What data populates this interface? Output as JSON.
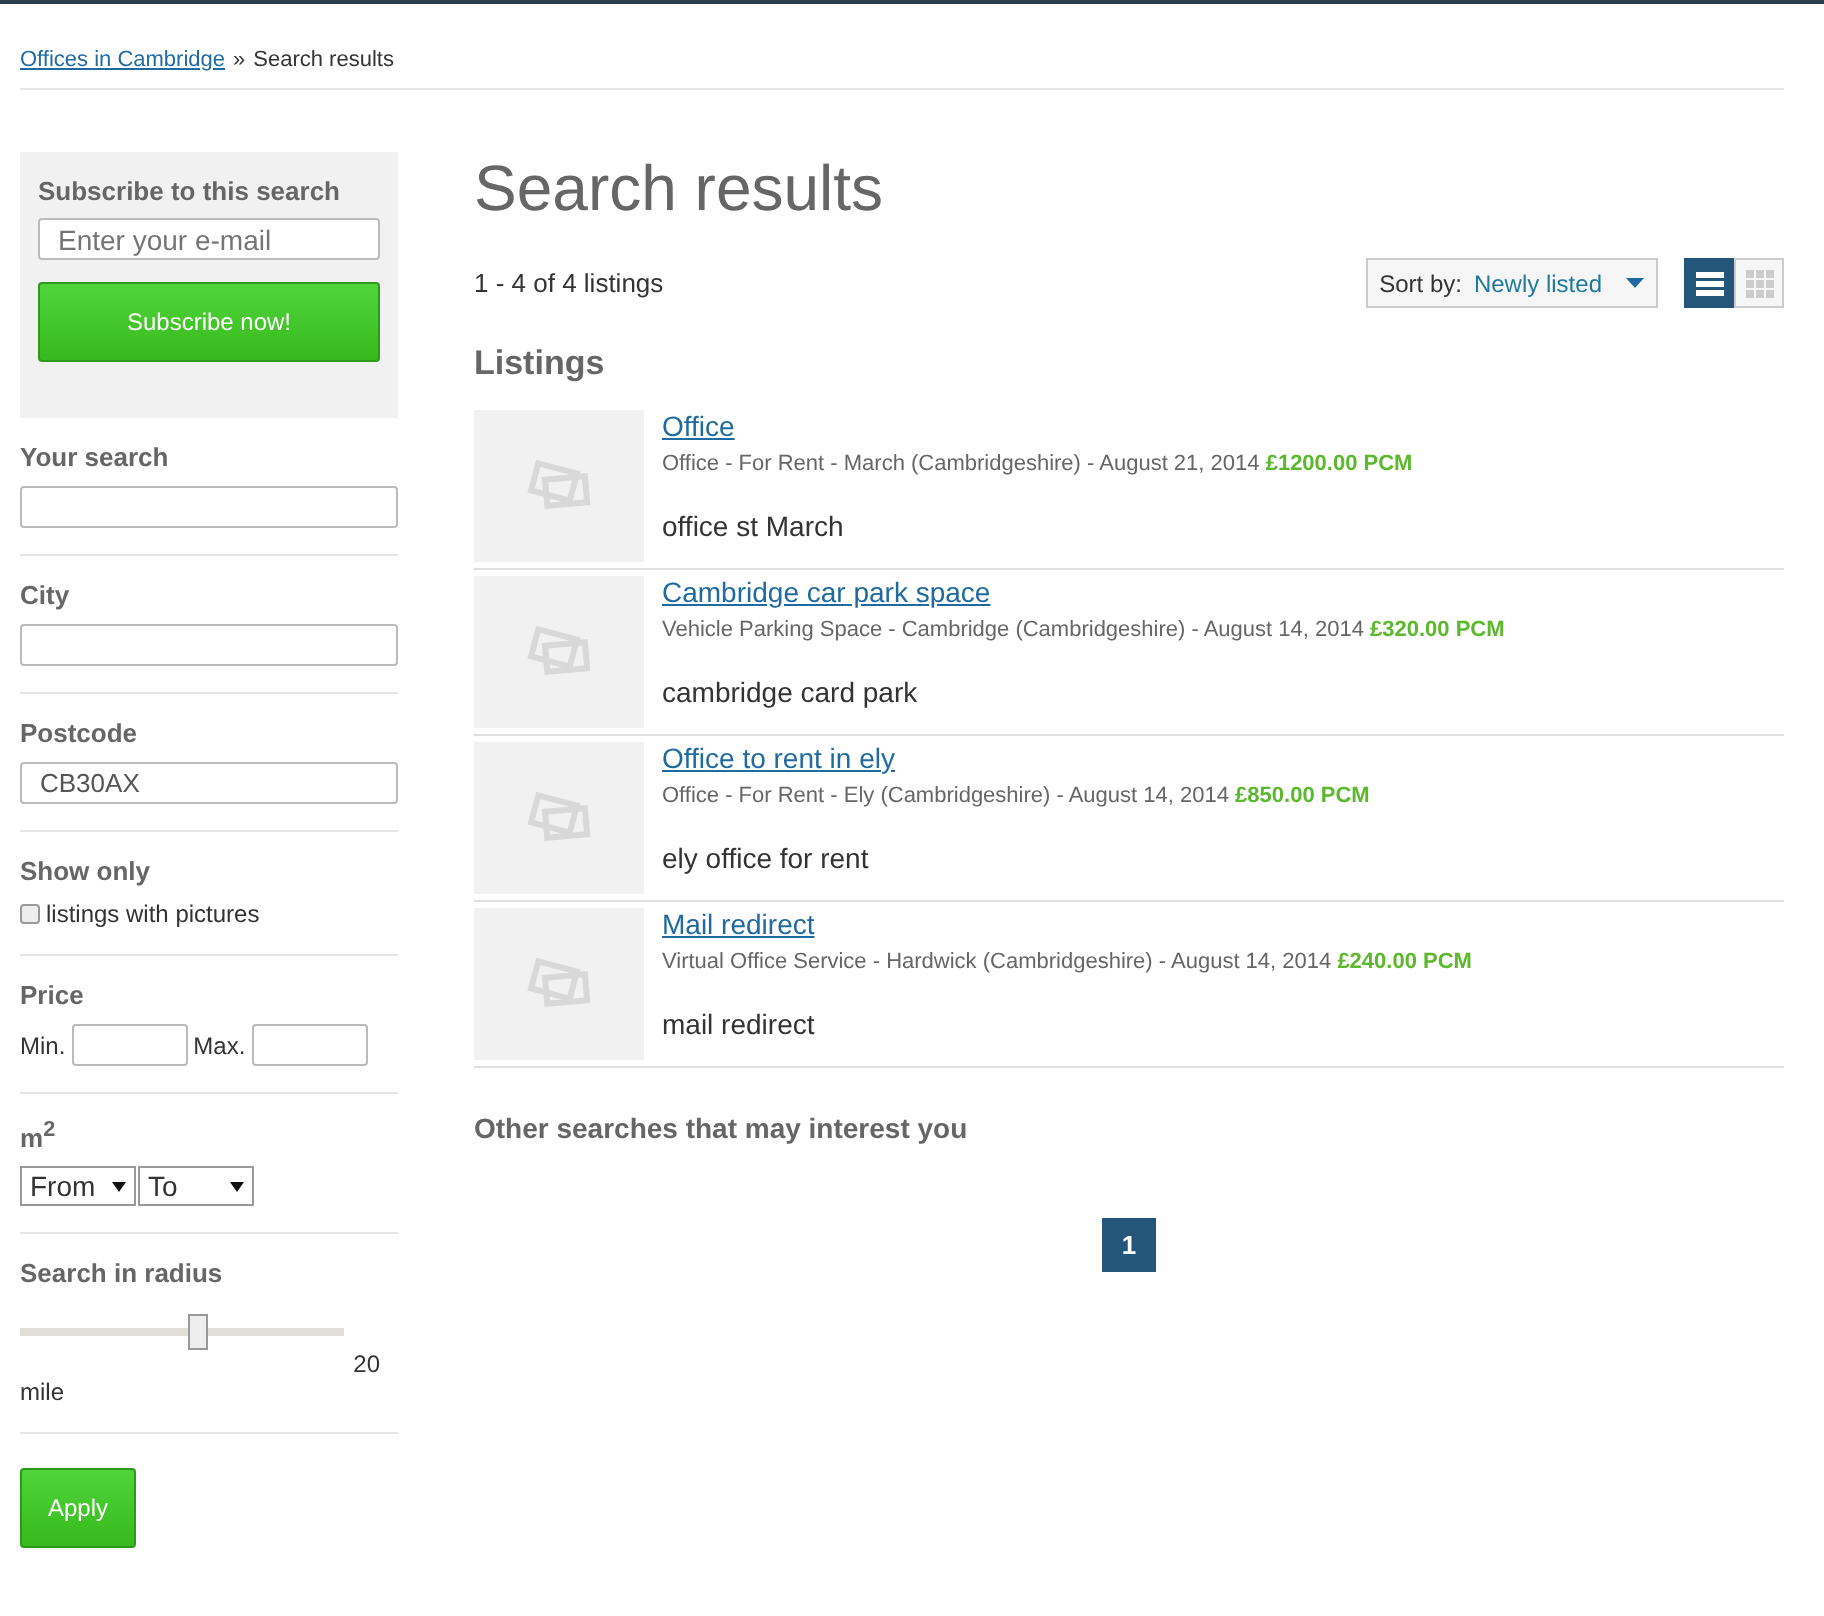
{
  "breadcrumb": {
    "link": "Offices in Cambridge",
    "separator": "»",
    "current": "Search results"
  },
  "subscribe": {
    "title": "Subscribe to this search",
    "placeholder": "Enter your e-mail",
    "button": "Subscribe now!"
  },
  "filters": [
    {
      "kind": "text",
      "label": "Your search"
    },
    {
      "kind": "text",
      "label": "City"
    },
    {
      "kind": "text",
      "label": "Postcode",
      "value": "CB30AX"
    },
    {
      "kind": "checkbox",
      "label": "Show only",
      "option": "listings with pictures",
      "checked": false
    },
    {
      "kind": "range",
      "label": "Price",
      "min_label": "Min.",
      "max_label": "Max."
    },
    {
      "kind": "selects",
      "label": "m$^{2}$",
      "from": "From",
      "to": "To"
    },
    {
      "kind": "slider",
      "label": "Search in radius",
      "level": 0.55,
      "reading": "20",
      "unit": "mile"
    }
  ],
  "apply_button": "Apply",
  "title": "Search results",
  "count": "1 - 4 of 4 listings",
  "sort": {
    "label": "Sort by:",
    "value": "Newly listed"
  },
  "views": [
    {
      "kind": "list",
      "selected": true
    },
    {
      "kind": "grid",
      "selected": false
    }
  ],
  "listings_heading": "Listings",
  "listings": [
    {
      "title": "Office",
      "meta": "Office - For Rent - March (Cambridgeshire) - August 21, 2014",
      "price": "£1200.00 PCM",
      "description": "office st March"
    },
    {
      "title": "Cambridge car park space",
      "meta": "Vehicle Parking Space - Cambridge (Cambridgeshire) - August 14, 2014",
      "price": "£320.00 PCM",
      "description": "cambridge card park"
    },
    {
      "title": "Office to rent in ely",
      "meta": "Office - For Rent - Ely (Cambridgeshire) - August 14, 2014",
      "price": "£850.00 PCM",
      "description": "ely office for rent"
    },
    {
      "title": "Mail redirect",
      "meta": "Virtual Office Service - Hardwick (Cambridgeshire) - August 14, 2014",
      "price": "£240.00 PCM",
      "description": "mail redirect"
    }
  ],
  "other_searches": "Other searches that may interest you",
  "pages": [
    {
      "label": "1",
      "selected": true
    }
  ]
}
